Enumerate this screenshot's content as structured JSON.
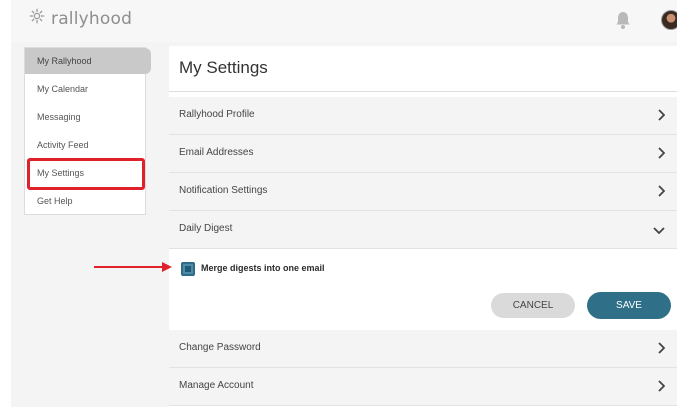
{
  "header": {
    "logo_text": "rallyhood",
    "logo_icon": "gear-flower-icon",
    "bell_icon": "bell-icon",
    "avatar_icon": "avatar"
  },
  "sidebar": {
    "items": [
      {
        "label": "My Rallyhood",
        "active": true
      },
      {
        "label": "My Calendar",
        "active": false
      },
      {
        "label": "Messaging",
        "active": false
      },
      {
        "label": "Activity Feed",
        "active": false
      },
      {
        "label": "My Settings",
        "active": false,
        "highlighted": true
      },
      {
        "label": "Get Help",
        "active": false
      }
    ]
  },
  "main": {
    "title": "My Settings",
    "sections": [
      {
        "label": "Rallyhood Profile",
        "icon": "chevron-right-icon"
      },
      {
        "label": "Email Addresses",
        "icon": "chevron-right-icon"
      },
      {
        "label": "Notification Settings",
        "icon": "chevron-right-icon"
      },
      {
        "label": "Daily Digest",
        "icon": "chevron-down-icon",
        "expanded": true
      },
      {
        "label": "Change Password",
        "icon": "chevron-right-icon"
      },
      {
        "label": "Manage Account",
        "icon": "chevron-right-icon"
      }
    ],
    "digest": {
      "checkbox_label": "Merge digests into one email",
      "checked": true,
      "cancel_label": "CANCEL",
      "save_label": "SAVE"
    }
  },
  "colors": {
    "accent": "#2f6f88",
    "highlight": "#e0212b",
    "annotation_arrow": "#e0212b"
  }
}
